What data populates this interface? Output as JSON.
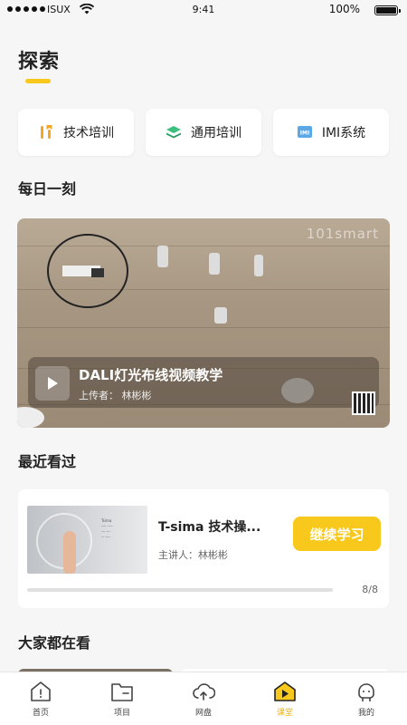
{
  "status_bar": {
    "carrier": "ISUX",
    "time": "9:41",
    "battery": "100%"
  },
  "page": {
    "title": "探索"
  },
  "categories": [
    {
      "label": "技术培训",
      "icon": "tools-icon"
    },
    {
      "label": "通用培训",
      "icon": "layers-icon"
    },
    {
      "label": "IMI系统",
      "icon": "imi-system-icon"
    }
  ],
  "daily": {
    "section_title": "每日一刻",
    "watermark": "101smart",
    "video_title": "DALI灯光布线视频教学",
    "uploader": "上传者：  林彬彬"
  },
  "recent": {
    "section_title": "最近看过",
    "title": "T-sima 技术操...",
    "speaker": "主讲人：林彬彬",
    "continue_label": "继续学习",
    "progress_text": "8/8",
    "progress_fraction": 1.0
  },
  "popular": {
    "section_title": "大家都在看"
  },
  "tabs": [
    {
      "label": "首页",
      "icon": "home-icon",
      "active": false
    },
    {
      "label": "项目",
      "icon": "folder-icon",
      "active": false
    },
    {
      "label": "网盘",
      "icon": "cloud-upload-icon",
      "active": false
    },
    {
      "label": "课堂",
      "icon": "classroom-play-icon",
      "active": true
    },
    {
      "label": "我的",
      "icon": "profile-icon",
      "active": false
    }
  ],
  "colors": {
    "accent": "#f8c91c"
  }
}
